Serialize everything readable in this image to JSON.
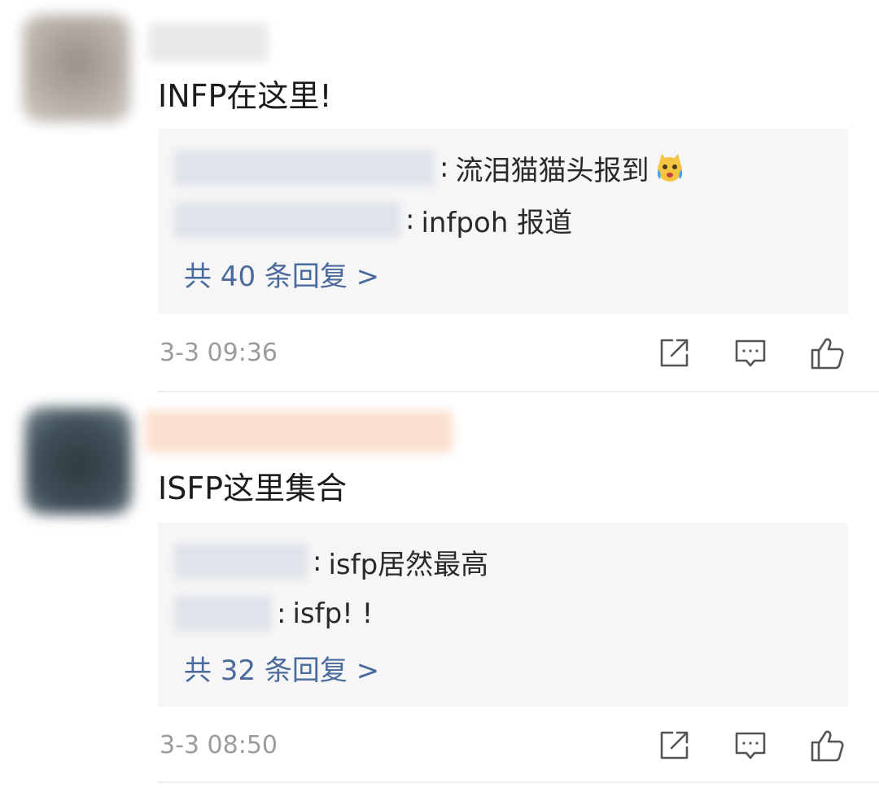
{
  "comments": [
    {
      "text": "INFP在这里!",
      "replies": [
        {
          "separator": ":",
          "text": "流泪猫猫头报到",
          "emoji": "crying-cat-face-emoji"
        },
        {
          "separator": ":",
          "text": "infpoh 报道"
        }
      ],
      "more_replies": "共 40 条回复 >",
      "timestamp": "3-3 09:36",
      "actions": [
        "share-icon",
        "comment-icon",
        "like-icon"
      ]
    },
    {
      "text": "ISFP这里集合",
      "replies": [
        {
          "separator": ":",
          "text": "isfp居然最高"
        },
        {
          "separator": ":",
          "text": "isfp! !"
        }
      ],
      "more_replies": "共 32 条回复 >",
      "timestamp": "3-3 08:50",
      "actions": [
        "share-icon",
        "comment-icon",
        "like-icon"
      ]
    }
  ],
  "colors": {
    "link": "#4a6a9c",
    "timestamp": "#9b9b9b",
    "reply_bg": "#f6f6f6",
    "divider": "#ececec",
    "avatar_1": "#a29a90",
    "avatar_2": "#37424a",
    "username_1_blur": "#e6e6e6",
    "username_2_blur": "#fbe0cf"
  }
}
